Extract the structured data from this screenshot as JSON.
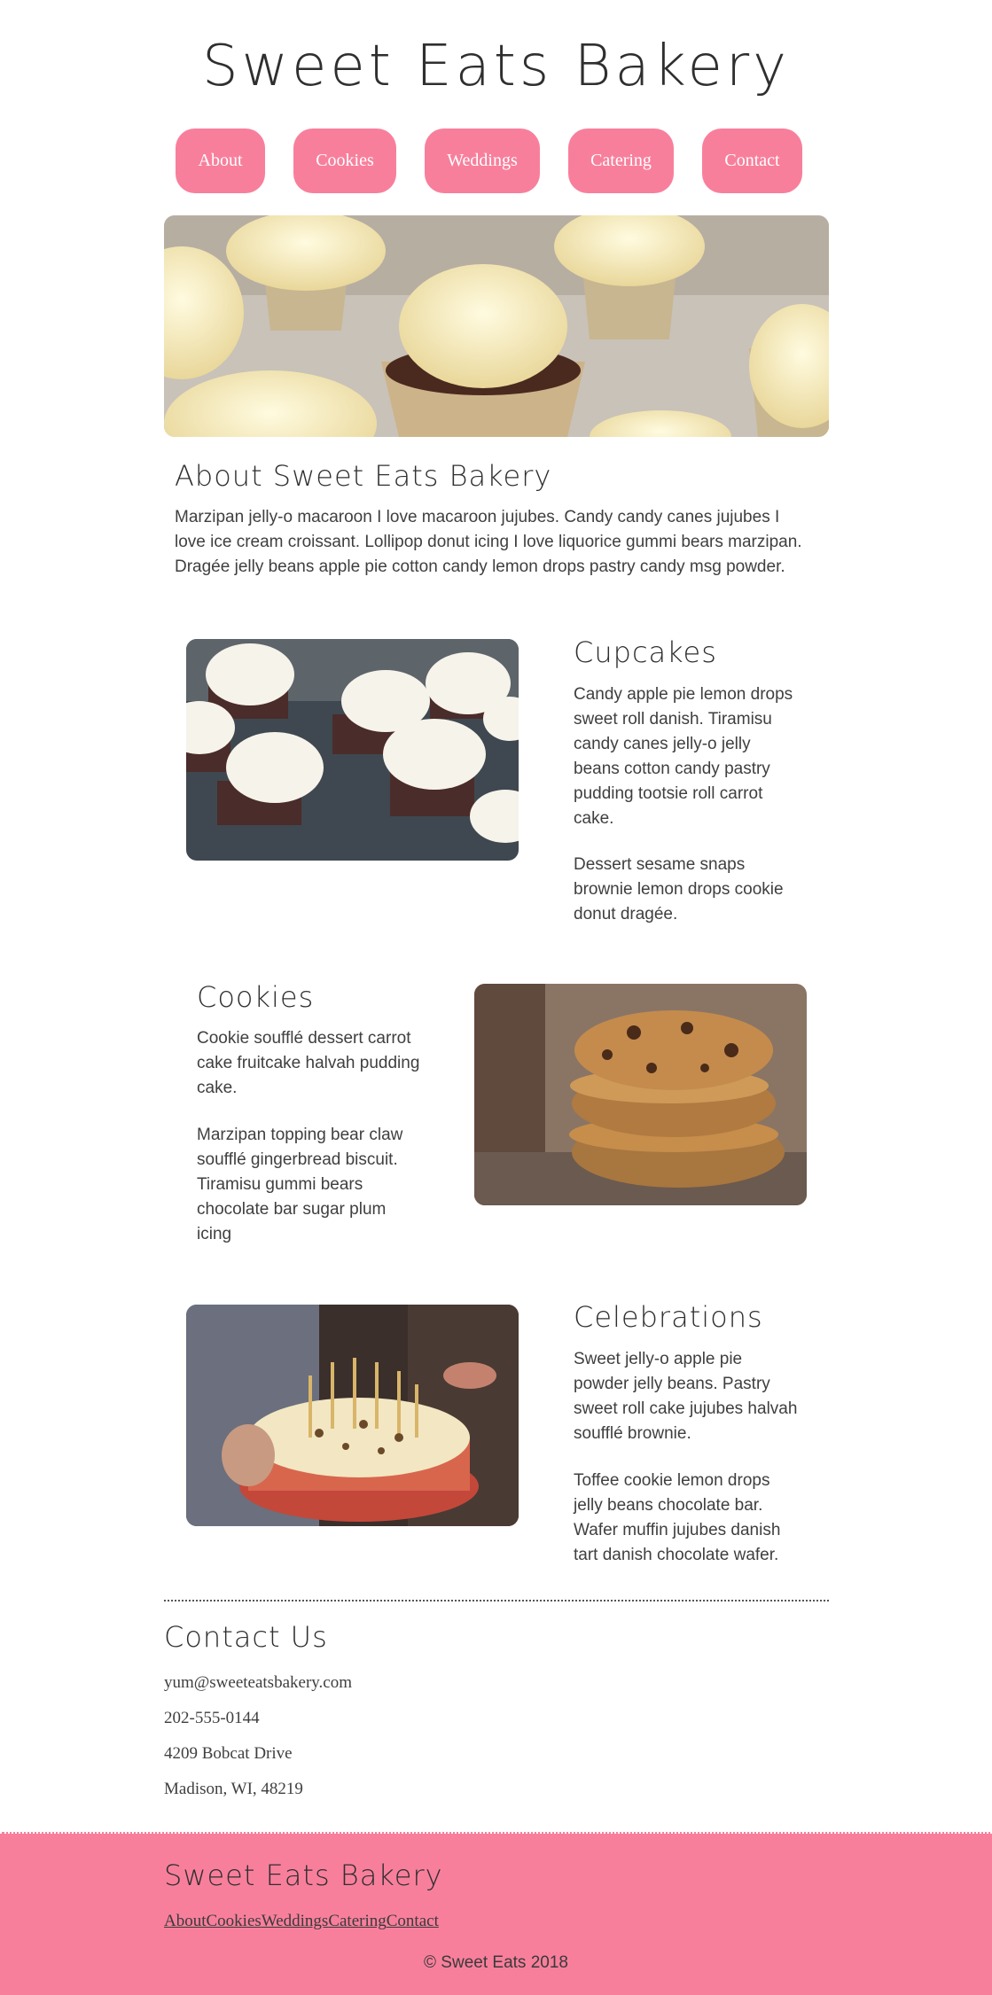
{
  "site": {
    "title": "Sweet Eats Bakery"
  },
  "nav": {
    "items": [
      {
        "label": "About"
      },
      {
        "label": "Cookies"
      },
      {
        "label": "Weddings"
      },
      {
        "label": "Catering"
      },
      {
        "label": "Contact"
      }
    ]
  },
  "about": {
    "title": "About Sweet Eats Bakery",
    "text": "Marzipan jelly-o macaroon I love macaroon jujubes. Candy candy canes jujubes I love ice cream croissant. Lollipop donut icing I love liquorice gummi bears marzipan. Dragée jelly beans apple pie cotton candy lemon drops pastry candy msg powder."
  },
  "sections": {
    "cupcakes": {
      "title": "Cupcakes",
      "paragraphs": [
        "Candy apple pie lemon drops sweet roll danish. Tiramisu candy canes jelly-o jelly beans cotton candy pastry pudding tootsie roll carrot cake.",
        "Dessert sesame snaps brownie lemon drops cookie donut dragée."
      ]
    },
    "cookies": {
      "title": "Cookies",
      "paragraphs": [
        "Cookie soufflé dessert carrot cake fruitcake halvah pudding cake.",
        "Marzipan topping bear claw soufflé gingerbread biscuit. Tiramisu gummi bears chocolate bar sugar plum icing"
      ]
    },
    "celebrations": {
      "title": "Celebrations",
      "paragraphs": [
        "Sweet jelly-o apple pie powder jelly beans. Pastry sweet roll cake jujubes halvah soufflé brownie.",
        "Toffee cookie lemon drops jelly beans chocolate bar. Wafer muffin jujubes danish tart danish chocolate wafer."
      ]
    }
  },
  "contact": {
    "title": "Contact Us",
    "email": "yum@sweeteatsbakery.com",
    "phone": "202-555-0144",
    "street": "4209 Bobcat Drive",
    "city": "Madison, WI, 48219"
  },
  "footer": {
    "title": "Sweet Eats Bakery",
    "links": [
      "About",
      "Cookies",
      "Weddings",
      "Catering",
      "Contact"
    ],
    "copyright": "© Sweet Eats 2018"
  },
  "colors": {
    "accent": "#f87f9c",
    "text": "#3a3a3a",
    "background": "#ffffff"
  }
}
